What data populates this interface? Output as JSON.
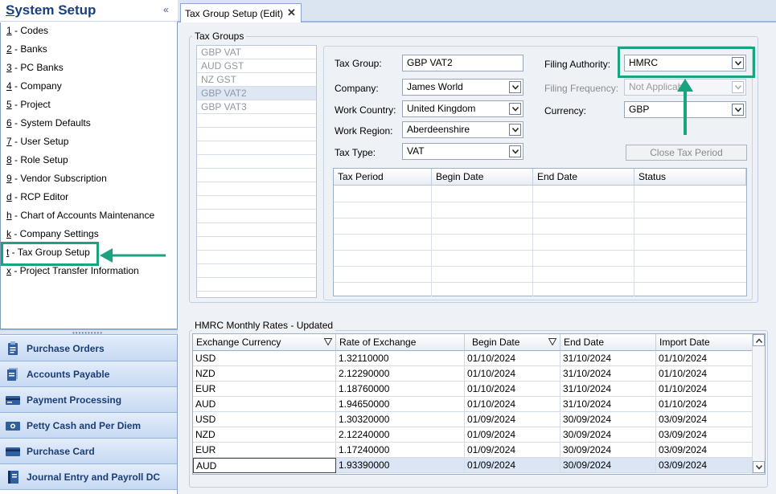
{
  "sidebar": {
    "title_first": "S",
    "title_rest": "ystem Setup",
    "collapse_glyph": "«",
    "items": [
      {
        "key": "1",
        "rest": " - Codes"
      },
      {
        "key": "2",
        "rest": " - Banks"
      },
      {
        "key": "3",
        "rest": " - PC Banks"
      },
      {
        "key": "4",
        "rest": " - Company"
      },
      {
        "key": "5",
        "rest": " - Project"
      },
      {
        "key": "6",
        "rest": " - System Defaults"
      },
      {
        "key": "7",
        "rest": " - User Setup"
      },
      {
        "key": "8",
        "rest": " - Role Setup"
      },
      {
        "key": "9",
        "rest": " - Vendor Subscription"
      },
      {
        "key": "d",
        "rest": " - RCP Editor"
      },
      {
        "key": "h",
        "rest": " - Chart of Accounts Maintenance"
      },
      {
        "key": "k",
        "rest": " - Company Settings"
      },
      {
        "key": "t",
        "rest": " - Tax Group Setup"
      },
      {
        "key": "x",
        "rest": " - Project Transfer Information"
      }
    ],
    "nav_buttons": [
      {
        "label": "Purchase Orders",
        "icon": "clipboard-icon"
      },
      {
        "label": "Accounts Payable",
        "icon": "documents-icon"
      },
      {
        "label": "Payment Processing",
        "icon": "credit-card-icon"
      },
      {
        "label": "Petty Cash and Per Diem",
        "icon": "cash-icon"
      },
      {
        "label": "Purchase Card",
        "icon": "card-icon"
      },
      {
        "label": "Journal Entry and Payroll DC",
        "icon": "journal-icon"
      }
    ]
  },
  "tab": {
    "label": "Tax Group Setup (Edit)",
    "close": "✕"
  },
  "tax_groups": {
    "caption": "Tax Groups",
    "list": [
      "GBP VAT",
      "AUD GST",
      "NZ GST",
      "GBP VAT2",
      "GBP VAT3"
    ],
    "selected": "GBP VAT2",
    "form": {
      "tax_group_label": "Tax Group:",
      "tax_group_value": "GBP VAT2",
      "company_label": "Company:",
      "company_value": "James World",
      "work_country_label": "Work Country:",
      "work_country_value": "United Kingdom",
      "work_region_label": "Work Region:",
      "work_region_value": "Aberdeenshire",
      "tax_type_label": "Tax Type:",
      "tax_type_value": "VAT",
      "filing_authority_label": "Filing Authority:",
      "filing_authority_value": "HMRC",
      "filing_frequency_label": "Filing Frequency:",
      "filing_frequency_value": "Not Applicable",
      "currency_label": "Currency:",
      "currency_value": "GBP",
      "close_period_button": "Close Tax Period"
    },
    "period_columns": [
      "Tax Period",
      "Begin Date",
      "End Date",
      "Status"
    ]
  },
  "rates": {
    "caption": "HMRC Monthly Rates - Updated",
    "columns": [
      "Exchange Currency",
      "Rate of Exchange",
      "Begin Date",
      "End Date",
      "Import Date"
    ],
    "rows": [
      [
        "USD",
        "1.32110000",
        "01/10/2024",
        "31/10/2024",
        "01/10/2024"
      ],
      [
        "NZD",
        "2.12290000",
        "01/10/2024",
        "31/10/2024",
        "01/10/2024"
      ],
      [
        "EUR",
        "1.18760000",
        "01/10/2024",
        "31/10/2024",
        "01/10/2024"
      ],
      [
        "AUD",
        "1.94650000",
        "01/10/2024",
        "31/10/2024",
        "01/10/2024"
      ],
      [
        "USD",
        "1.30320000",
        "01/09/2024",
        "30/09/2024",
        "03/09/2024"
      ],
      [
        "NZD",
        "2.12240000",
        "01/09/2024",
        "30/09/2024",
        "03/09/2024"
      ],
      [
        "EUR",
        "1.17240000",
        "01/09/2024",
        "30/09/2024",
        "03/09/2024"
      ],
      [
        "AUD",
        "1.93390000",
        "01/09/2024",
        "30/09/2024",
        "03/09/2024"
      ]
    ]
  },
  "colors": {
    "accent_highlight": "#1aa37f",
    "header_text": "#1a3f7d"
  }
}
